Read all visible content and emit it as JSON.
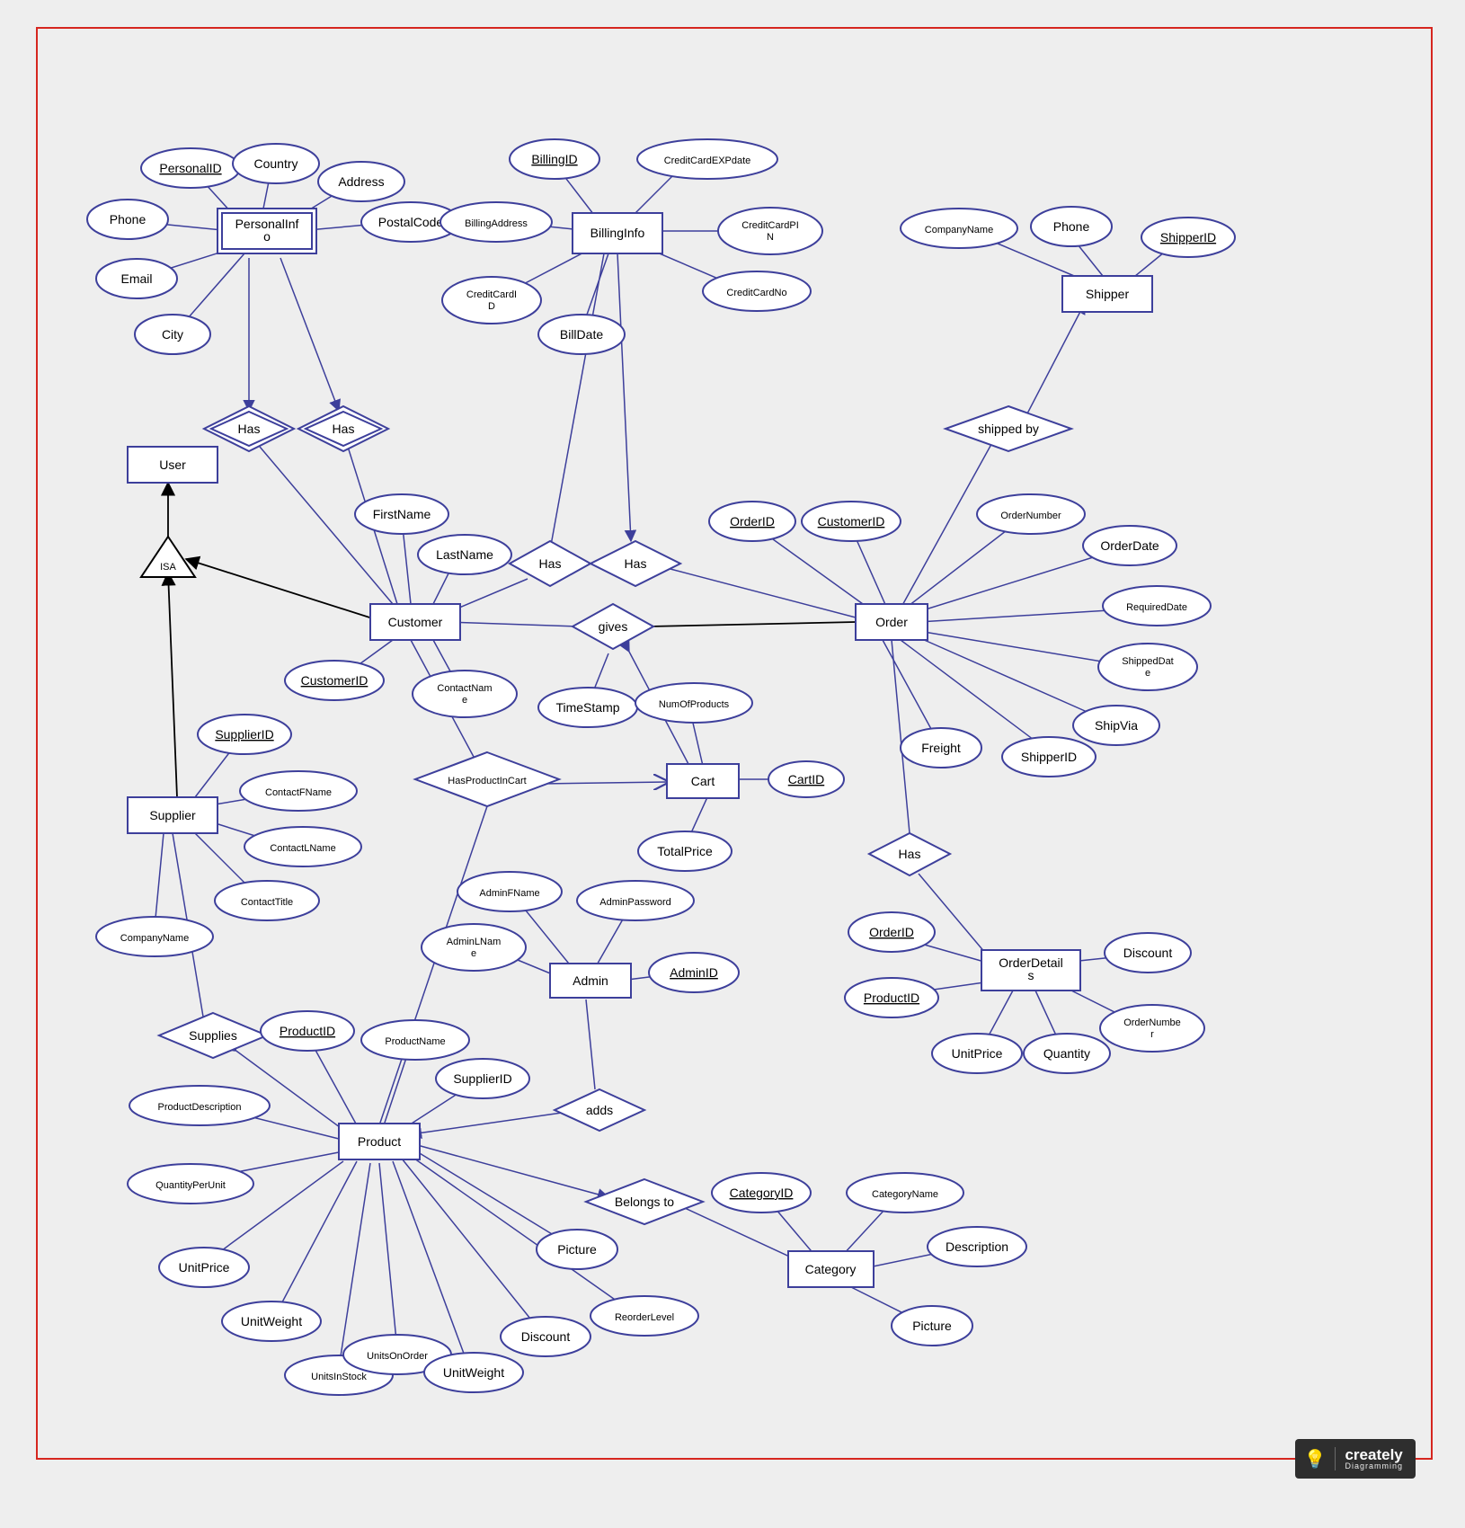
{
  "brand": {
    "name": "creately",
    "tag": "Diagramming"
  },
  "entities": {
    "User": "User",
    "PersonalInfo": "PersonalInfo",
    "BillingInfo": "BillingInfo",
    "Shipper": "Shipper",
    "Customer": "Customer",
    "Order": "Order",
    "Cart": "Cart",
    "OrderDetails": "OrderDetails",
    "Supplier": "Supplier",
    "Admin": "Admin",
    "Product": "Product",
    "Category": "Category"
  },
  "relationships": {
    "Has1": "Has",
    "Has2": "Has",
    "Has3": "Has",
    "Has4": "Has",
    "Has5": "Has",
    "gives": "gives",
    "shipped_by": "shipped by",
    "HasProductInCart": "HasProductInCart",
    "Supplies": "Supplies",
    "adds": "adds",
    "BelongsTo": "Belongs to",
    "ISA": "ISA"
  },
  "attributes": {
    "PersonalInfo": {
      "PersonalID": "PersonalID",
      "Country": "Country",
      "Address": "Address",
      "PostalCode": "PostalCode",
      "Phone": "Phone",
      "Email": "Email",
      "City": "City"
    },
    "BillingInfo": {
      "BillingID": "BillingID",
      "CreditCardEXPdate": "CreditCardEXPdate",
      "BillingAddress": "BillingAddress",
      "CreditCardPIN": "CreditCardPIN",
      "CreditCardID": "CreditCardID",
      "CreditCardNo": "CreditCardNo",
      "BillDate": "BillDate"
    },
    "Shipper": {
      "CompanyName": "CompanyName",
      "Phone": "Phone",
      "ShipperID": "ShipperID"
    },
    "Customer": {
      "FirstName": "FirstName",
      "LastName": "LastName",
      "CustomerID": "CustomerID",
      "ContactName": "ContactName"
    },
    "Order": {
      "OrderID": "OrderID",
      "CustomerID": "CustomerID",
      "OrderNumber": "OrderNumber",
      "OrderDate": "OrderDate",
      "RequiredDate": "RequiredDate",
      "ShippedDate": "ShippedDate",
      "ShipVia": "ShipVia",
      "ShipperID": "ShipperID",
      "Freight": "Freight"
    },
    "gives": {
      "TimeStamp": "TimeStamp"
    },
    "Cart": {
      "NumOfProducts": "NumOfProducts",
      "CartID": "CartID",
      "TotalPrice": "TotalPrice"
    },
    "OrderDetails": {
      "OrderID": "OrderID",
      "ProductID": "ProductID",
      "UnitPrice": "UnitPrice",
      "Quantity": "Quantity",
      "OrderNumber": "OrderNumber",
      "Discount": "Discount"
    },
    "Supplier": {
      "SupplierID": "SupplierID",
      "ContactFName": "ContactFName",
      "ContactLName": "ContactLName",
      "ContactTitle": "ContactTitle",
      "CompanyName": "CompanyName"
    },
    "Admin": {
      "AdminFName": "AdminFName",
      "AdminPassword": "AdminPassword",
      "AdminLName": "AdminLName",
      "AdminID": "AdminID"
    },
    "Product": {
      "ProductID": "ProductID",
      "ProductName": "ProductName",
      "SupplierID": "SupplierID",
      "ProductDescription": "ProductDescription",
      "QuantityPerUnit": "QuantityPerUnit",
      "UnitPrice": "UnitPrice",
      "UnitWeight": "UnitWeight",
      "UnitsInStock": "UnitsInStock",
      "UnitsOnOrder": "UnitsOnOrder",
      "UnitWeight2": "UnitWeight",
      "Discount": "Discount",
      "ReorderLevel": "ReorderLevel",
      "Picture": "Picture"
    },
    "Category": {
      "CategoryID": "CategoryID",
      "CategoryName": "CategoryName",
      "Description": "Description",
      "Picture": "Picture"
    }
  }
}
